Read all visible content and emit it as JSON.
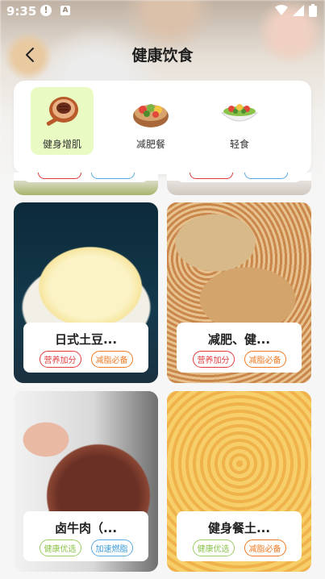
{
  "status": {
    "time": "9:35"
  },
  "nav": {
    "title": "健康饮食"
  },
  "categories": [
    {
      "label": "健身增肌",
      "active": true,
      "icon": "steak-plate-icon"
    },
    {
      "label": "减肥餐",
      "active": false,
      "icon": "salad-bowl-icon"
    },
    {
      "label": "轻食",
      "active": false,
      "icon": "light-salad-icon"
    }
  ],
  "cards": [
    {
      "name": "日式土豆...",
      "tags": [
        "营养加分",
        "减脂必备"
      ],
      "tag_colors": [
        "red",
        "orange"
      ]
    },
    {
      "name": "减肥、健...",
      "tags": [
        "营养加分",
        "减脂必备"
      ],
      "tag_colors": [
        "red",
        "orange"
      ]
    },
    {
      "name": "卤牛肉（...",
      "tags": [
        "健康优选",
        "加速燃脂"
      ],
      "tag_colors": [
        "green",
        "blue"
      ]
    },
    {
      "name": "健身餐土...",
      "tags": [
        "健康优选",
        "减脂必备"
      ],
      "tag_colors": [
        "green",
        "orange"
      ]
    }
  ],
  "colors": {
    "active_category": "#e9fbc2",
    "accent_red": "#e23b3b",
    "accent_orange": "#ef7a23",
    "accent_green": "#8bc34a",
    "accent_blue": "#3a9ad9"
  }
}
